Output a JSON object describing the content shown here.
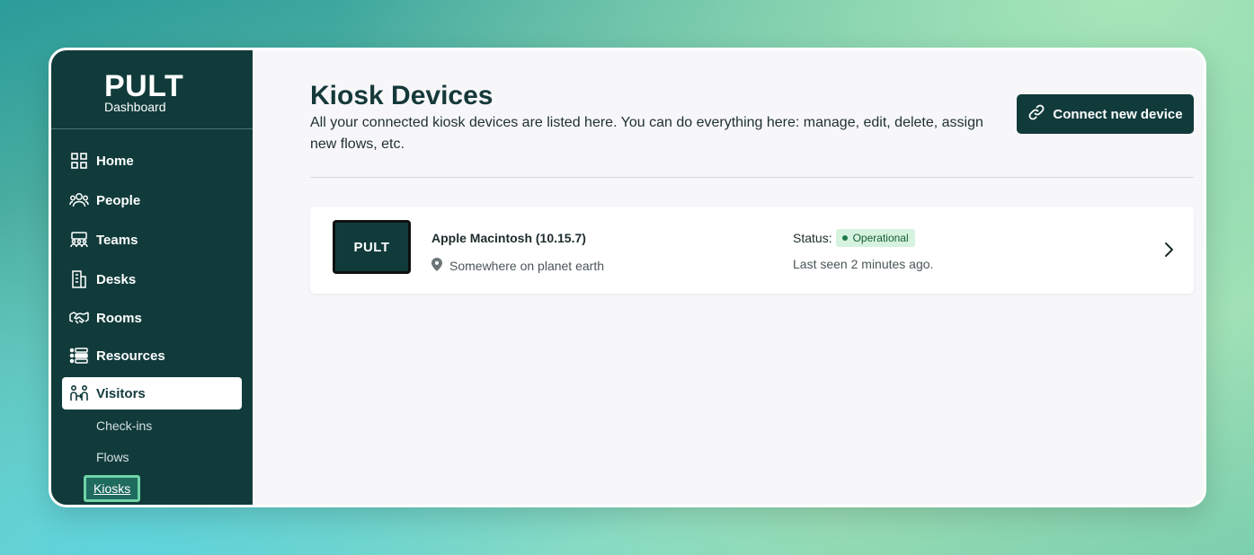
{
  "brand": {
    "logo": "PULT",
    "subtitle": "Dashboard"
  },
  "sidebar": {
    "items": [
      {
        "label": "Home",
        "icon": "grid-icon"
      },
      {
        "label": "People",
        "icon": "people-icon"
      },
      {
        "label": "Teams",
        "icon": "teams-icon"
      },
      {
        "label": "Desks",
        "icon": "desk-building-icon"
      },
      {
        "label": "Rooms",
        "icon": "handshake-icon"
      },
      {
        "label": "Resources",
        "icon": "resources-list-icon"
      },
      {
        "label": "Visitors",
        "icon": "visitors-icon",
        "active": true
      }
    ],
    "subitems": [
      {
        "label": "Check-ins"
      },
      {
        "label": "Flows"
      },
      {
        "label": "Kiosks",
        "current": true
      }
    ]
  },
  "main": {
    "title": "Kiosk Devices",
    "description": "All your connected kiosk devices are listed here. You can do everything here: manage, edit, delete, assign new flows, etc.",
    "connect_button": {
      "label": "Connect new device",
      "icon": "link-icon"
    }
  },
  "devices": [
    {
      "thumbnail_text": "PULT",
      "name": "Apple Macintosh (10.15.7)",
      "location": "Somewhere on planet earth",
      "status_label": "Status:",
      "status": "Operational",
      "last_seen": "Last seen 2 minutes ago."
    }
  ],
  "colors": {
    "sidebar_bg": "#113b3b",
    "accent": "#113b3b",
    "status_badge_bg": "#d5f3df",
    "status_badge_text": "#155c36",
    "current_subitem_border": "#6fd3a8"
  }
}
